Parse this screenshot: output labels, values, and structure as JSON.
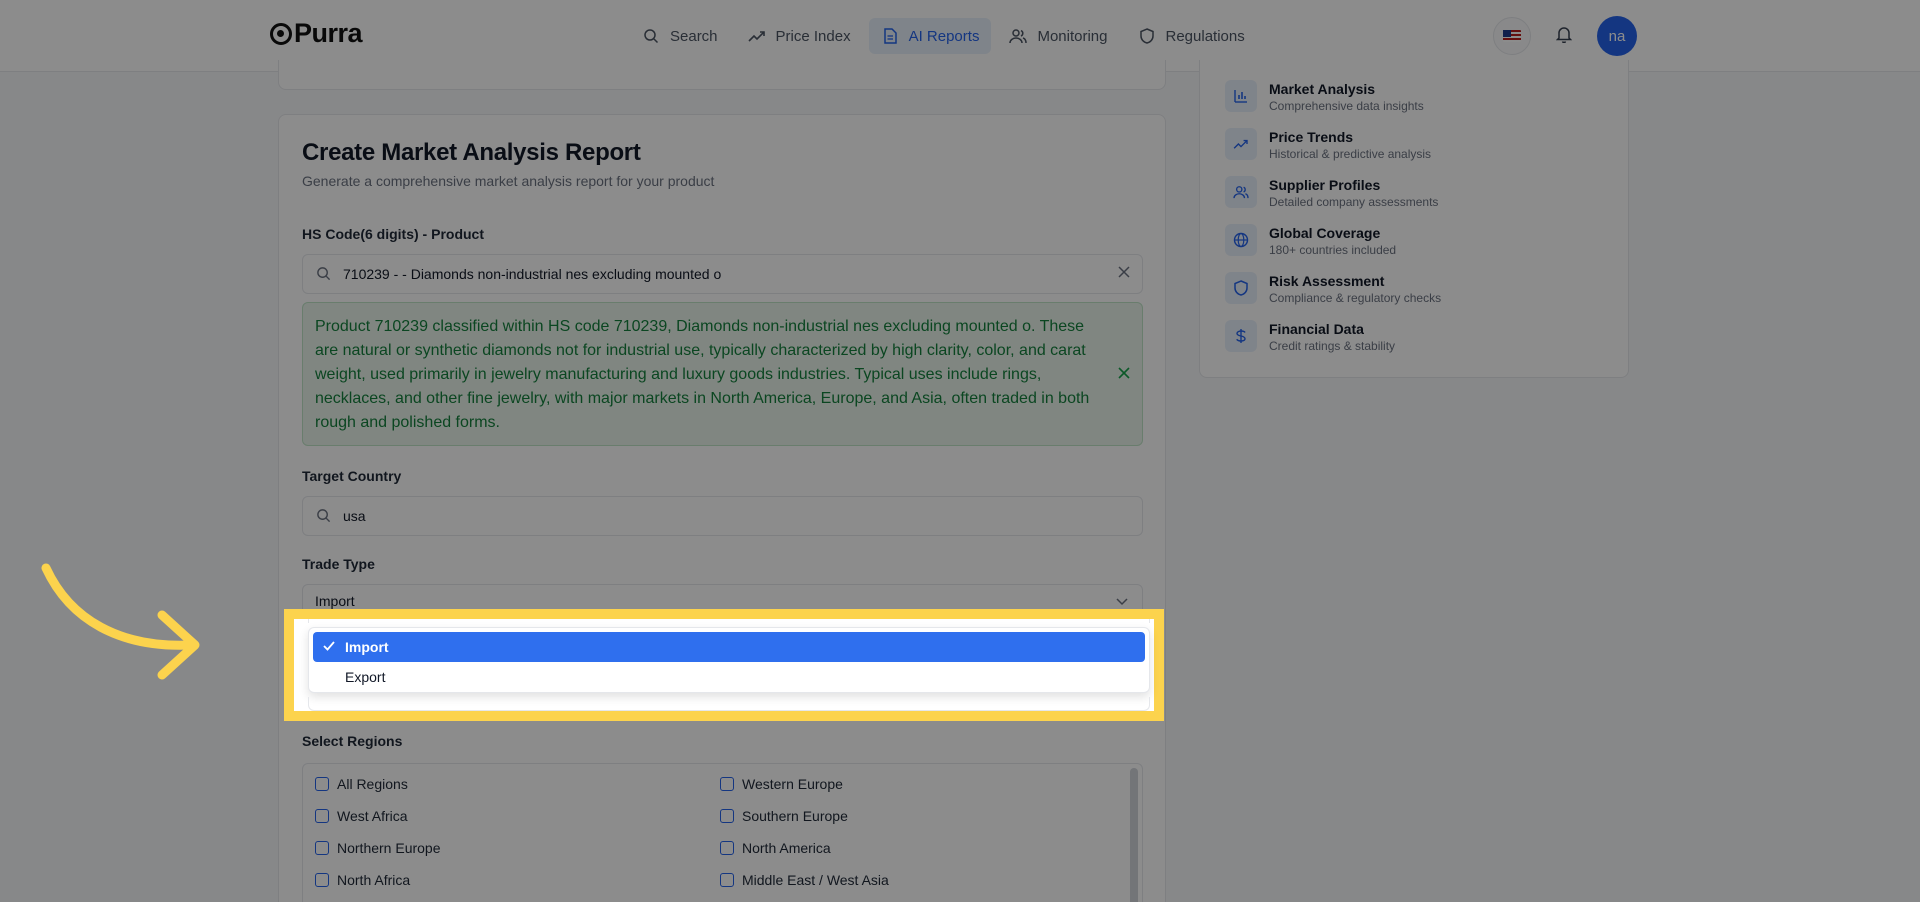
{
  "header": {
    "logo": "Purra",
    "nav": [
      {
        "label": "Search",
        "icon": "search-icon",
        "active": false
      },
      {
        "label": "Price Index",
        "icon": "trending-up-icon",
        "active": false
      },
      {
        "label": "AI Reports",
        "icon": "document-icon",
        "active": true
      },
      {
        "label": "Monitoring",
        "icon": "users-icon",
        "active": false
      },
      {
        "label": "Regulations",
        "icon": "shield-icon",
        "active": false
      }
    ],
    "avatar_initials": "na"
  },
  "form": {
    "title": "Create Market Analysis Report",
    "subtitle": "Generate a comprehensive market analysis report for your product",
    "hs_label": "HS Code(6 digits) - Product",
    "hs_value": "710239 - - Diamonds non-industrial nes excluding mounted o",
    "description": "Product 710239 classified within HS code 710239, Diamonds non-industrial nes excluding mounted o. These are natural or synthetic diamonds not for industrial use, typically characterized by high clarity, color, and carat weight, used primarily in jewelry manufacturing and luxury goods industries. Typical uses include rings, necklaces, and other fine jewelry, with major markets in North America, Europe, and Asia, often traded in both rough and polished forms.",
    "country_label": "Target Country",
    "country_value": "usa",
    "trade_label": "Trade Type",
    "trade_value": "Import",
    "trade_options": [
      {
        "label": "Import",
        "selected": true
      },
      {
        "label": "Export",
        "selected": false
      }
    ],
    "regions_label": "Select Regions",
    "regions": [
      {
        "label": "All Regions"
      },
      {
        "label": "Western Europe"
      },
      {
        "label": "West Africa"
      },
      {
        "label": "Southern Europe"
      },
      {
        "label": "Northern Europe"
      },
      {
        "label": "North America"
      },
      {
        "label": "North Africa"
      },
      {
        "label": "Middle East / West Asia"
      }
    ]
  },
  "features": [
    {
      "title": "Market Analysis",
      "desc": "Comprehensive data insights",
      "icon": "bar-chart-icon"
    },
    {
      "title": "Price Trends",
      "desc": "Historical & predictive analysis",
      "icon": "trending-up-icon"
    },
    {
      "title": "Supplier Profiles",
      "desc": "Detailed company assessments",
      "icon": "users-icon"
    },
    {
      "title": "Global Coverage",
      "desc": "180+ countries included",
      "icon": "globe-icon"
    },
    {
      "title": "Risk Assessment",
      "desc": "Compliance & regulatory checks",
      "icon": "shield-icon"
    },
    {
      "title": "Financial Data",
      "desc": "Credit ratings & stability",
      "icon": "dollar-icon"
    }
  ],
  "colors": {
    "accent": "#2563eb",
    "highlight": "#fcd34d",
    "success_bg": "#eaf5ec",
    "success_text": "#15803d"
  }
}
